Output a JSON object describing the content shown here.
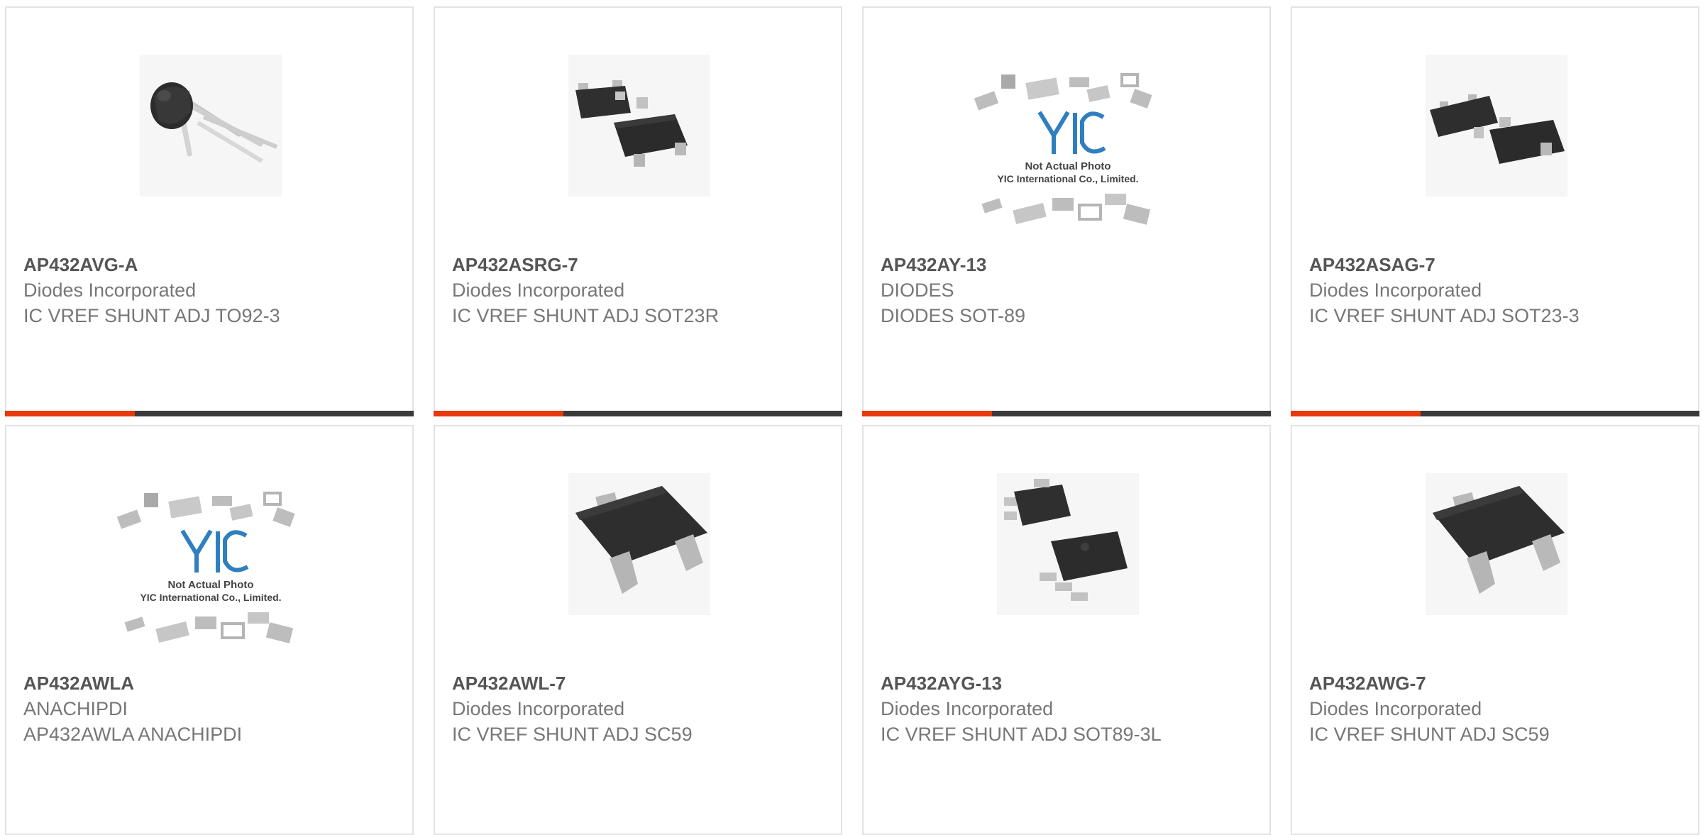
{
  "colors": {
    "accent": "#e8380d",
    "bar": "#3a3a3a",
    "border": "#e3e3e3"
  },
  "products": [
    {
      "part_number": "AP432AVG-A",
      "manufacturer": "Diodes Incorporated",
      "description": "IC VREF SHUNT ADJ TO92-3",
      "image": "to92-package"
    },
    {
      "part_number": "AP432ASRG-7",
      "manufacturer": "Diodes Incorporated",
      "description": "IC VREF SHUNT ADJ SOT23R",
      "image": "sot23-package"
    },
    {
      "part_number": "AP432AY-13",
      "manufacturer": "DIODES",
      "description": "DIODES SOT-89",
      "image": "not-actual-photo",
      "photo_note": "Not Actual Photo",
      "photo_company": "YIC International Co., Limited."
    },
    {
      "part_number": "AP432ASAG-7",
      "manufacturer": "Diodes Incorporated",
      "description": "IC VREF SHUNT ADJ SOT23-3",
      "image": "sot23-package"
    },
    {
      "part_number": "AP432AWLA",
      "manufacturer": "ANACHIPDI",
      "description": "AP432AWLA ANACHIPDI",
      "image": "not-actual-photo",
      "photo_note": "Not Actual Photo",
      "photo_company": "YIC International Co., Limited."
    },
    {
      "part_number": "AP432AWL-7",
      "manufacturer": "Diodes Incorporated",
      "description": "IC VREF SHUNT ADJ SC59",
      "image": "sc59-package"
    },
    {
      "part_number": "AP432AYG-13",
      "manufacturer": "Diodes Incorporated",
      "description": "IC VREF SHUNT ADJ SOT89-3L",
      "image": "sot89-package"
    },
    {
      "part_number": "AP432AWG-7",
      "manufacturer": "Diodes Incorporated",
      "description": "IC VREF SHUNT ADJ SC59",
      "image": "sc59-package"
    }
  ]
}
